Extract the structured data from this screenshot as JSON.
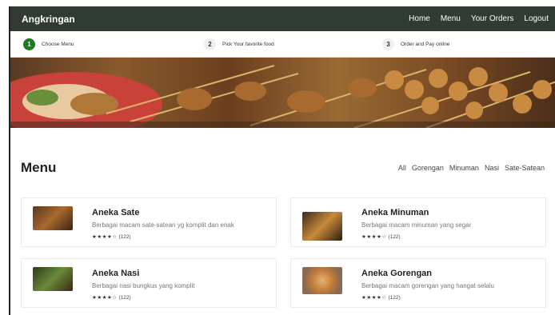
{
  "app": {
    "brand": "Angkringan"
  },
  "nav": {
    "items": [
      "Home",
      "Menu",
      "Your Orders",
      "Logout"
    ]
  },
  "steps": [
    {
      "num": "1",
      "label": "Choose Menu",
      "active": true
    },
    {
      "num": "2",
      "label": "Pick Your favorite food",
      "active": false
    },
    {
      "num": "3",
      "label": "Order and Pay online",
      "active": false
    }
  ],
  "menu": {
    "title": "Menu",
    "filters": [
      "All",
      "Gorengan",
      "Minuman",
      "Nasi",
      "Sate-Satean"
    ]
  },
  "cards": [
    {
      "name": "Aneka Sate",
      "desc": "Berbagai macam sate-satean yg komplit dan enak",
      "stars": "★★★★☆",
      "count": "(122)",
      "image": "sate-image"
    },
    {
      "name": "Aneka Minuman",
      "desc": "Berbagai macam minuman yang segar",
      "stars": "★★★★☆",
      "count": "(122)",
      "image": "drinks-image"
    },
    {
      "name": "Aneka Nasi",
      "desc": "Berbagai nasi bungkus yang komplit",
      "stars": "★★★★☆",
      "count": "(122)",
      "image": "rice-image"
    },
    {
      "name": "Aneka Gorengan",
      "desc": "Berbagai macam gorengan yang hangat selalu",
      "stars": "★★★★☆",
      "count": "(122)",
      "image": "fried-food-image"
    }
  ],
  "colors": {
    "navbar": "#2f3b33",
    "step_active": "#1f7a1f"
  }
}
